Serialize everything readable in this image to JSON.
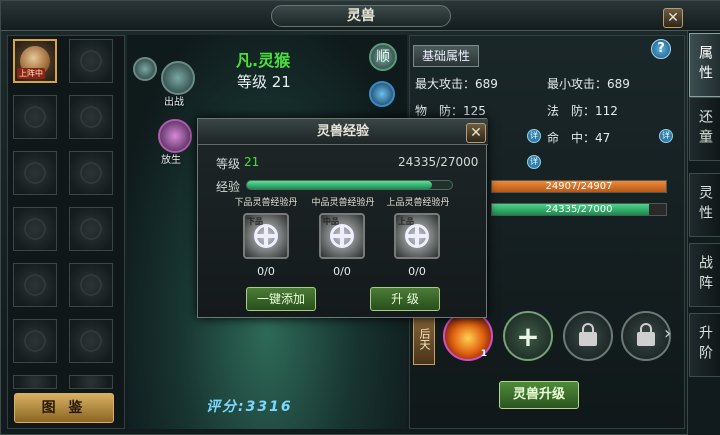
{
  "window": {
    "title": "灵兽",
    "close": "✕"
  },
  "left_panel": {
    "active_tag": "上阵中",
    "book_button": "图 鉴"
  },
  "scene": {
    "pet_name": "凡.灵猴",
    "level_text": "等级 21",
    "battle_label": "出战",
    "release_label": "放生",
    "score": "评分:3316",
    "shun_label": "顺"
  },
  "info": {
    "basic_tab": "基础属性",
    "help": "?",
    "stats": {
      "max_attack": "最大攻击：689",
      "min_attack": "最小攻击：689",
      "phys_def": "物　防：125",
      "mag_def": "法　防：112",
      "hit": "命　中：47"
    },
    "hp_bar": {
      "text": "24907/24907",
      "fraction": 1.0
    },
    "exp_bar": {
      "text": "24335/27000",
      "fraction": 0.9013
    },
    "info_icon": "详"
  },
  "skills": {
    "houtian": "后天",
    "fire_count": "1",
    "add": "+",
    "next": "›",
    "upgrade_button": "灵兽升级"
  },
  "right_tabs": [
    "属性",
    "还童",
    "灵性",
    "战阵",
    "升阶"
  ],
  "dialog": {
    "title": "灵兽经验",
    "close": "✕",
    "level_label": "等级",
    "level_value": "21",
    "exp_value": "24335/27000",
    "exp_label": "经验",
    "exp_fraction": 0.9013,
    "pills": [
      {
        "name": "下品灵兽经验丹",
        "grade": "下品",
        "count": "0/0"
      },
      {
        "name": "中品灵兽经验丹",
        "grade": "中品",
        "count": "0/0"
      },
      {
        "name": "上品灵兽经验丹",
        "grade": "上品",
        "count": "0/0"
      }
    ],
    "add_all_button": "一键添加",
    "upgrade_button": "升 级"
  },
  "colors": {
    "accent_green": "#49e03c",
    "hp_orange": "#f08a3a",
    "exp_green": "#4ed28a"
  }
}
